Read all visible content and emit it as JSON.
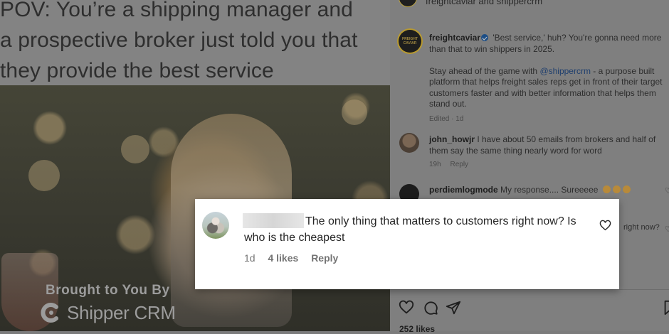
{
  "post": {
    "headline": "POV: You’re a shipping manager and\na prospective broker just told you that\nthey provide the best service",
    "brought_by": "Brought to You By",
    "brand_name": "Shipper CRM"
  },
  "panel": {
    "header": "freightcaviar and shippercrm",
    "avatar_logo_text": "FREIGHT CAVIAR",
    "caption": {
      "username": "freightcaviar",
      "text": "'Best service,' huh? You're gonna need more than that to win shippers in 2025.",
      "text2_prefix": "Stay ahead of the game with ",
      "mention": "@shippercrm",
      "text2_suffix": " - a purpose built platform that helps freight sales reps get in front of their target customers faster and with better information that helps them stand out.",
      "meta": "Edited · 1d"
    },
    "comments": [
      {
        "username": "john_howjr",
        "text": "I have about 50 emails from brokers and half of them say the same thing nearly word for word",
        "time": "19h",
        "reply": "Reply"
      },
      {
        "username": "perdiemlogmode",
        "text": "My response.... Sureeeee"
      }
    ],
    "partial_text": "right now?",
    "likes": "252 likes"
  },
  "highlight": {
    "comment": "The only thing that matters to customers right now? Is who is the cheapest",
    "time": "1d",
    "likes": "4 likes",
    "reply": "Reply"
  },
  "colors": {
    "overlay": "#7f7f7f",
    "card": "#ffffff",
    "text": "#262626",
    "meta": "#737373"
  }
}
